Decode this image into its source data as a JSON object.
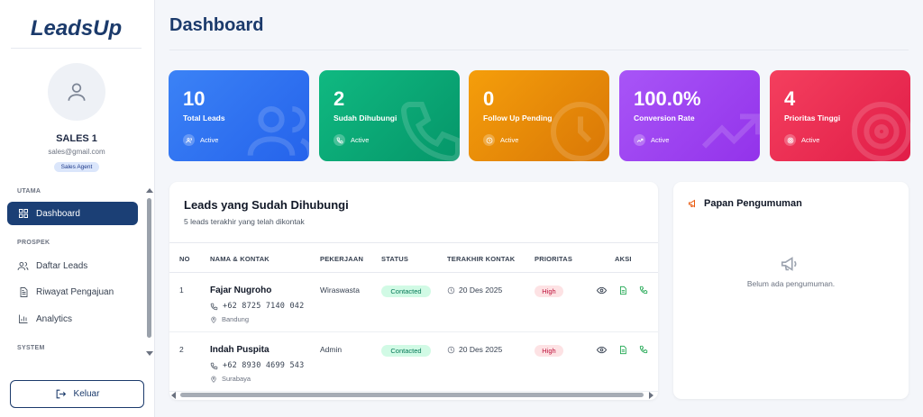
{
  "app": {
    "brand": "LeadsUp"
  },
  "user": {
    "name": "SALES 1",
    "email": "sales@gmail.com",
    "role": "Sales Agent"
  },
  "sidebar": {
    "sections": {
      "utama": "UTAMA",
      "prospek": "PROSPEK",
      "system": "SYSTEM"
    },
    "items": [
      {
        "label": "Dashboard",
        "icon": "grid-icon",
        "active": true
      },
      {
        "label": "Daftar Leads",
        "icon": "users-icon"
      },
      {
        "label": "Riwayat Pengajuan",
        "icon": "file-icon"
      },
      {
        "label": "Analytics",
        "icon": "bar-chart-icon"
      }
    ],
    "logout_label": "Keluar"
  },
  "page": {
    "title": "Dashboard"
  },
  "stats": [
    {
      "value": "10",
      "label": "Total Leads",
      "status": "Active",
      "color_from": "#3b82f6",
      "color_to": "#2563eb",
      "icon": "users-icon"
    },
    {
      "value": "2",
      "label": "Sudah Dihubungi",
      "status": "Active",
      "color_from": "#10b981",
      "color_to": "#059669",
      "icon": "phone-icon"
    },
    {
      "value": "0",
      "label": "Follow Up Pending",
      "status": "Active",
      "color_from": "#f59e0b",
      "color_to": "#d97706",
      "icon": "clock-icon"
    },
    {
      "value": "100.0%",
      "label": "Conversion Rate",
      "status": "Active",
      "color_from": "#a855f7",
      "color_to": "#9333ea",
      "icon": "trend-icon"
    },
    {
      "value": "4",
      "label": "Prioritas Tinggi",
      "status": "Active",
      "color_from": "#f43f5e",
      "color_to": "#e11d48",
      "icon": "target-icon"
    }
  ],
  "leads": {
    "title": "Leads yang Sudah Dihubungi",
    "subtitle": "5 leads terakhir yang telah dikontak",
    "columns": [
      "NO",
      "NAMA & KONTAK",
      "PEKERJAAN",
      "STATUS",
      "TERAKHIR KONTAK",
      "PRIORITAS",
      "AKSI"
    ],
    "rows": [
      {
        "no": "1",
        "name": "Fajar Nugroho",
        "phone": "+62 8725 7140 042",
        "city": "Bandung",
        "job": "Wiraswasta",
        "status": "Contacted",
        "last_contact": "20 Des 2025",
        "priority": "High"
      },
      {
        "no": "2",
        "name": "Indah Puspita",
        "phone": "+62 8930 4699 543",
        "city": "Surabaya",
        "job": "Admin",
        "status": "Contacted",
        "last_contact": "20 Des 2025",
        "priority": "High"
      }
    ]
  },
  "announcements": {
    "title": "Papan Pengumuman",
    "empty_text": "Belum ada pengumuman."
  },
  "colors": {
    "primary": "#1b3a6b",
    "nav_active": "#1b3f75",
    "status_green": "#047857",
    "priority_red": "#be123c"
  }
}
